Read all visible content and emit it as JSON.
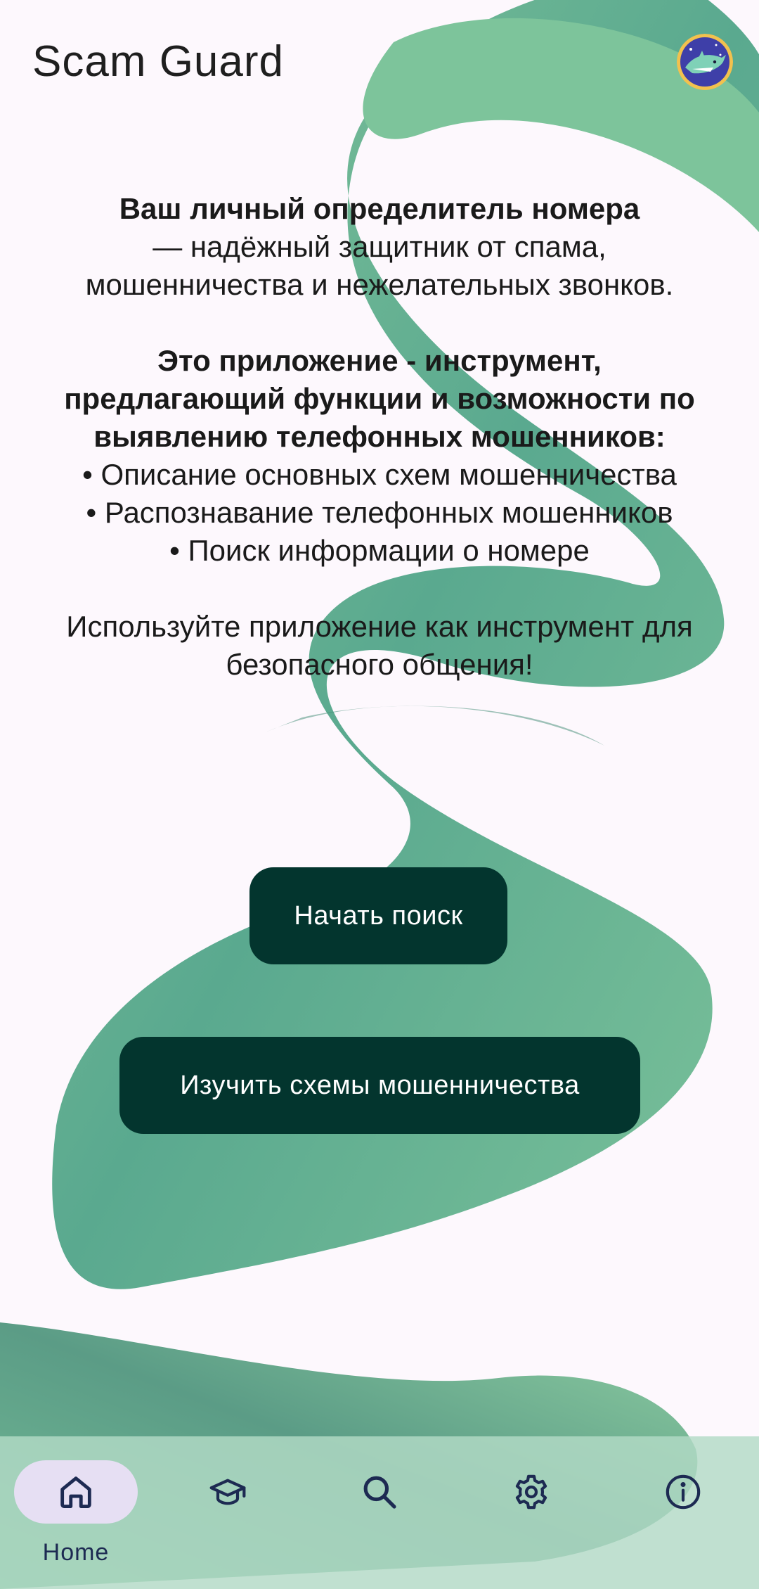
{
  "app": {
    "title": "Scam Guard"
  },
  "intro": {
    "heading": "Ваш личный определитель номера",
    "subtitle_line1": "— надёжный защитник от спама,",
    "subtitle_line2": "мошенничества и нежелательных звонков.",
    "tool_line1": "Это приложение - инструмент,",
    "tool_line2": "предлагающий функции и возможности по",
    "tool_line3": "выявлению телефонных мошенников:",
    "features": [
      "• Описание основных схем мошенничества",
      "• Распознавание телефонных мошенников",
      "• Поиск информации о номере"
    ],
    "closing_line1": "Используйте приложение как инструмент для",
    "closing_line2": "безопасного общения!"
  },
  "buttons": {
    "start_search": "Начать поиск",
    "learn_schemes": "Изучить схемы мошенничества"
  },
  "nav": {
    "items": [
      {
        "icon": "home-icon",
        "label": "Home",
        "selected": true
      },
      {
        "icon": "graduation-cap-icon",
        "label": "",
        "selected": false
      },
      {
        "icon": "search-icon",
        "label": "",
        "selected": false
      },
      {
        "icon": "gear-icon",
        "label": "",
        "selected": false
      },
      {
        "icon": "info-icon",
        "label": "",
        "selected": false
      }
    ]
  },
  "colors": {
    "background": "#fdf8fd",
    "button": "#03352e",
    "nav_bar": "#b2dbc6",
    "nav_selected_pill": "#e6dff3",
    "nav_icon": "#1d2a52",
    "ribbon_light": "#86c79c",
    "ribbon_dark": "#4e9c85"
  }
}
